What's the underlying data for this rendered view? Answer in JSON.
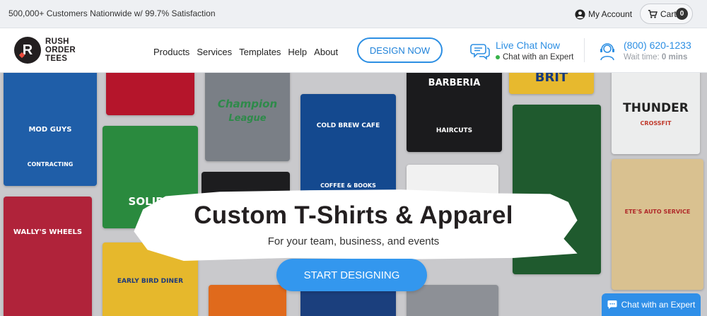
{
  "topbar": {
    "promo": "500,000+ Customers Nationwide w/ 99.7% Satisfaction",
    "account_label": "My Account",
    "cart_label": "Cart",
    "cart_count": "0"
  },
  "header": {
    "logo_lines": [
      "RUSH",
      "ORDER",
      "TEES"
    ],
    "logo_letter": "R",
    "nav": [
      "Products",
      "Services",
      "Templates",
      "Help",
      "About"
    ],
    "design_button": "DESIGN NOW",
    "live_chat": {
      "title": "Live Chat Now",
      "subtitle": "Chat with an Expert"
    },
    "phone": {
      "number": "(800) 620-1233",
      "wait_label": "Wait time:",
      "wait_value": "0 mins"
    }
  },
  "hero": {
    "title": "Custom T-Shirts & Apparel",
    "subtitle": "For your team, business, and events",
    "cta": "START DESIGNING",
    "shirt_prints": {
      "mod_guys": "MOD GUYS",
      "contracting": "CONTRACTING",
      "champion": "Champion",
      "league": "League",
      "barberia": "BARBERIA",
      "haircuts": "HAIRCUTS",
      "brit": "BRIT",
      "thunder": "THUNDER",
      "crossfit": "CROSSFIT",
      "solids": "SOLIDS",
      "cold_brew": "COLD BREW CAFE",
      "coffee_books": "COFFEE & BOOKS",
      "wallys": "WALLY'S WHEELS",
      "early_bird": "EARLY BIRD DINER",
      "auto_service": "ETE'S AUTO SERVICE"
    }
  },
  "chat_widget": {
    "label": "Chat with an Expert"
  },
  "colors": {
    "accent": "#2d8fe3",
    "cta": "#3397ee",
    "online": "#38b24a"
  }
}
